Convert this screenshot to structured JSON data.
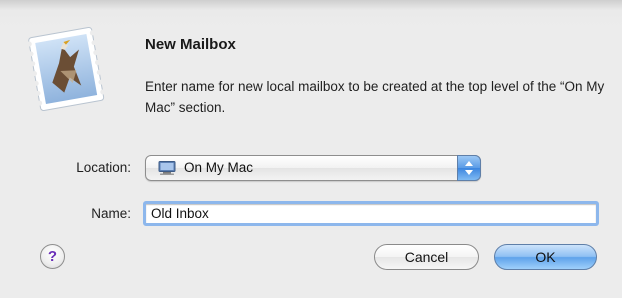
{
  "dialog": {
    "title": "New Mailbox",
    "message": "Enter name for new local mailbox to be created at the top level of the “On My Mac” section.",
    "icon": "mail-stamp-icon"
  },
  "location": {
    "label": "Location:",
    "selected": "On My Mac",
    "icon": "computer-icon"
  },
  "name": {
    "label": "Name:",
    "value": "Old Inbox"
  },
  "buttons": {
    "help": "?",
    "cancel": "Cancel",
    "ok": "OK"
  },
  "colors": {
    "default_button": "#5ea2ea",
    "focus_ring": "#8db7ec",
    "help_glyph": "#6a2fb8"
  }
}
